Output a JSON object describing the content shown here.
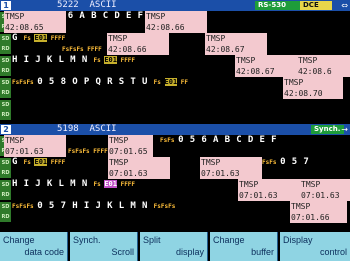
{
  "panel1": {
    "number": "1",
    "title": "5222  ASCII",
    "rs_badge": "RS-530",
    "dce_badge": "DCE",
    "arrow": "⇔",
    "rows": [
      {
        "sd": "               Fs Fs Fs 0 5 6 A B C D E F",
        "rd": "                      ",
        "ts": [
          {
            "label": "TMSP",
            "value": "42:08.65"
          },
          {
            "label": "TMSP",
            "value": "42:08.66"
          }
        ]
      },
      {
        "sd": "G Fs [HL:E01] F F F F  TMSP",
        "rd": "                      ",
        "ts": [
          {
            "label": "TMSP",
            "value": "42:08.66"
          },
          {
            "label": "TMSP",
            "value": "42:08.67"
          }
        ]
      },
      {
        "sd": "H I J K L M N Fs [HL:E01] F F F F",
        "rd": "",
        "ts": [
          {
            "label": "TMSP",
            "value": "42:08.67"
          },
          {
            "label": "TMSP",
            "value": "42:08.6"
          }
        ]
      },
      {
        "sd": "Fs Fs Fs 0 5 8 O P Q R S T U Fs [HL:E01] F F",
        "rd": "",
        "ts": [
          {
            "label": "TMSP",
            "value": "42:08.70"
          }
        ]
      }
    ]
  },
  "panel2": {
    "number": "2",
    "title": "5198  ASCII",
    "sync_badge": "Synch.",
    "arrow": "→",
    "rows": [
      {
        "ts": [
          {
            "label": "TMSP",
            "value": "07:01.63"
          },
          {
            "label": "TMSP",
            "value": "07:01.65"
          }
        ]
      },
      {
        "ts": [
          {
            "label": "TMSP",
            "value": "07:01.63"
          },
          {
            "label": "TMSP",
            "value": "07:01.63"
          }
        ]
      },
      {
        "ts": [
          {
            "label": "TMSP",
            "value": "07:01.63"
          },
          {
            "label": "TMSP",
            "value": "07:01.63"
          }
        ]
      },
      {
        "ts": [
          {
            "label": "TMSP",
            "value": "07:01.66"
          }
        ]
      }
    ]
  },
  "line_labels": {
    "sd": "SD",
    "rd": "RD"
  },
  "fkeys": [
    {
      "line1": "Change",
      "line2": "data code"
    },
    {
      "line1": "Synch.",
      "line2": "Scroll"
    },
    {
      "line1": "Split",
      "line2": "display"
    },
    {
      "line1": "Change",
      "line2": "buffer"
    },
    {
      "line1": "Display",
      "line2": "control"
    }
  ],
  "colors": {
    "header_bg": "#1b4fa8",
    "timestamp_bg": "#f3c9cf",
    "fkey_bg": "#8fd4e3",
    "tag_bg": "#2f7a2a",
    "highlight": "#c7b02c"
  }
}
